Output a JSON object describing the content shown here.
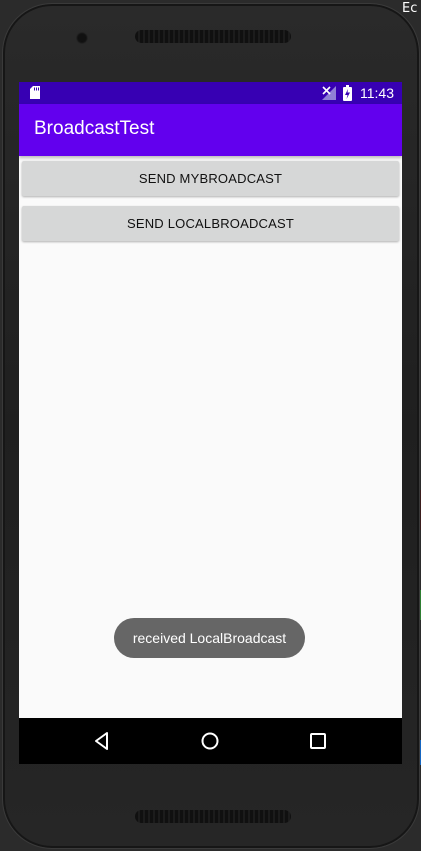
{
  "external": {
    "corner_label": "Ec"
  },
  "status_bar": {
    "time": "11:43",
    "icons": [
      "sd-card-icon",
      "no-signal-icon",
      "battery-charging-icon"
    ],
    "color": "#3700b3"
  },
  "app_bar": {
    "title": "BroadcastTest",
    "color": "#6200ee"
  },
  "main": {
    "buttons": [
      {
        "label": "SEND MYBROADCAST"
      },
      {
        "label": "SEND LOCALBROADCAST"
      }
    ]
  },
  "toast": {
    "text": "received LocalBroadcast"
  },
  "nav_bar": {
    "items": [
      "back-icon",
      "home-icon",
      "recents-icon"
    ]
  }
}
